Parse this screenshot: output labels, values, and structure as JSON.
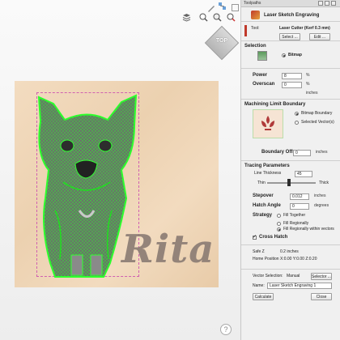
{
  "viewport": {
    "view_cube_label": "TOP",
    "help_glyph": "?",
    "sign_text": "Rita",
    "toolbar_icons": [
      "layers-icon",
      "zoom-in-icon",
      "zoom-fit-icon",
      "zoom-out-icon"
    ]
  },
  "panel": {
    "title": "Toolpaths",
    "header": "Laser Sketch Engraving",
    "tool": {
      "label": "Tool:",
      "name": "Laser Cutter (Kerf 0.3 mm)",
      "select_label": "Select ...",
      "edit_label": "Edit ..."
    },
    "selection": {
      "heading": "Selection",
      "option": "Bitmap"
    },
    "power": {
      "label": "Power",
      "value": "8",
      "unit": "%"
    },
    "overscan": {
      "label": "Overscan",
      "value": "0",
      "unit": "%",
      "unit2": "inches"
    },
    "machining": {
      "heading": "Machining Limit Boundary",
      "option1": "Bitmap Boundary",
      "option2": "Selected Vector(s)",
      "offset_label": "Boundary Offset",
      "offset_value": "0",
      "offset_unit": "inches"
    },
    "tracing": {
      "heading": "Tracing Parameters",
      "line_thickness_label": "Line Thickness",
      "line_thickness_value": "45",
      "thin_label": "Thin",
      "thick_label": "Thick",
      "slider_value": 0.45,
      "stepover_label": "Stepover",
      "stepover_value": "0.012",
      "stepover_unit": "inches",
      "hatch_label": "Hatch Angle",
      "hatch_value": "0",
      "hatch_unit": "degrees"
    },
    "strategy": {
      "label": "Strategy",
      "opt1": "Fill Together",
      "opt2": "Fill Regionally",
      "opt3": "Fill Regionally within vectors"
    },
    "cross_hatch": "Cross Hatch",
    "safe": {
      "label": "Safe Z",
      "value": "0.2 inches"
    },
    "home": {
      "label": "Home Position",
      "value": "X:0.00 Y:0.00 Z:0.20"
    },
    "vector_selection": {
      "label": "Vector Selection:",
      "value": "Manual",
      "button": "Selector ..."
    },
    "name": {
      "label": "Name:",
      "value": "Laser Sketch Engraving 1"
    },
    "calculate_label": "Calculate",
    "close_label": "Close"
  }
}
